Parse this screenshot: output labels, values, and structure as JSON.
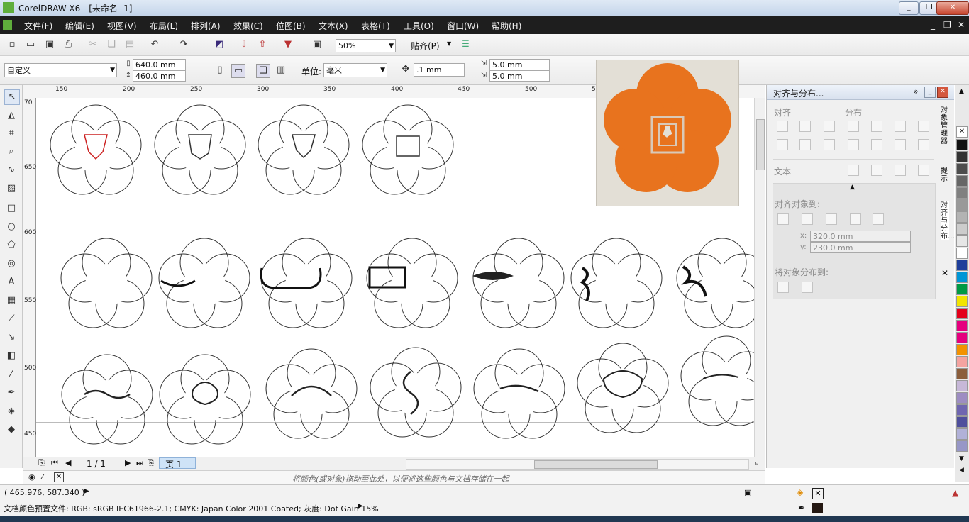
{
  "window": {
    "title": "CorelDRAW X6 - [未命名 -1]"
  },
  "menu": {
    "items": [
      "文件(F)",
      "编辑(E)",
      "视图(V)",
      "布局(L)",
      "排列(A)",
      "效果(C)",
      "位图(B)",
      "文本(X)",
      "表格(T)",
      "工具(O)",
      "窗口(W)",
      "帮助(H)"
    ]
  },
  "toolbar": {
    "zoom": "50%",
    "snap_label": "贴齐(P)"
  },
  "propbar": {
    "preset": "自定义",
    "width": "640.0 mm",
    "height": "460.0 mm",
    "units_label": "单位:",
    "units_value": "毫米",
    "nudge": ".1 mm",
    "dup_x": "5.0 mm",
    "dup_y": "5.0 mm"
  },
  "ruler": {
    "h": [
      "150",
      "200",
      "250",
      "300",
      "350",
      "400",
      "450",
      "500",
      "5"
    ],
    "v": [
      "70",
      "650",
      "600",
      "550",
      "500",
      "450"
    ]
  },
  "pagenav": {
    "counter": "1 / 1",
    "tab": "页 1"
  },
  "palette_hint": "将颜色(或对象)拖动至此处，以便将这些颜色与文档存储在一起",
  "docker": {
    "title": "对齐与分布...",
    "align": "对齐",
    "distribute": "分布",
    "text": "文本",
    "align_to": "对齐对象到:",
    "x_label": "x:",
    "x_value": "320.0 mm",
    "y_label": "y:",
    "y_value": "230.0 mm",
    "distribute_to": "将对象分布到:",
    "tabs": [
      "对象管理器",
      "提示",
      "对齐与分布..."
    ]
  },
  "status": {
    "coords": "( 465.976, 587.340 )",
    "profile": "文档颜色预置文件: RGB: sRGB IEC61966-2.1; CMYK: Japan Color 2001 Coated; 灰度: Dot Gain 15%"
  },
  "colors": {
    "palette": [
      "#ffffff",
      "#000000",
      "#1a1a1a",
      "#333333",
      "#4d4d4d",
      "#666666",
      "#808080",
      "#999999",
      "#b3b3b3",
      "#cccccc",
      "#e6e6e6",
      "#ffffff",
      "#1f3f9a",
      "#0096d6",
      "#009a44",
      "#f2e400",
      "#e3001b",
      "#e5007e",
      "#f39200",
      "#f4a3a0",
      "#8b5e3c",
      "#c7b8d8",
      "#9d8dc2",
      "#6f66b0",
      "#4f4f9c",
      "#b1b1d8"
    ],
    "photo_orange": "#e8731e"
  }
}
